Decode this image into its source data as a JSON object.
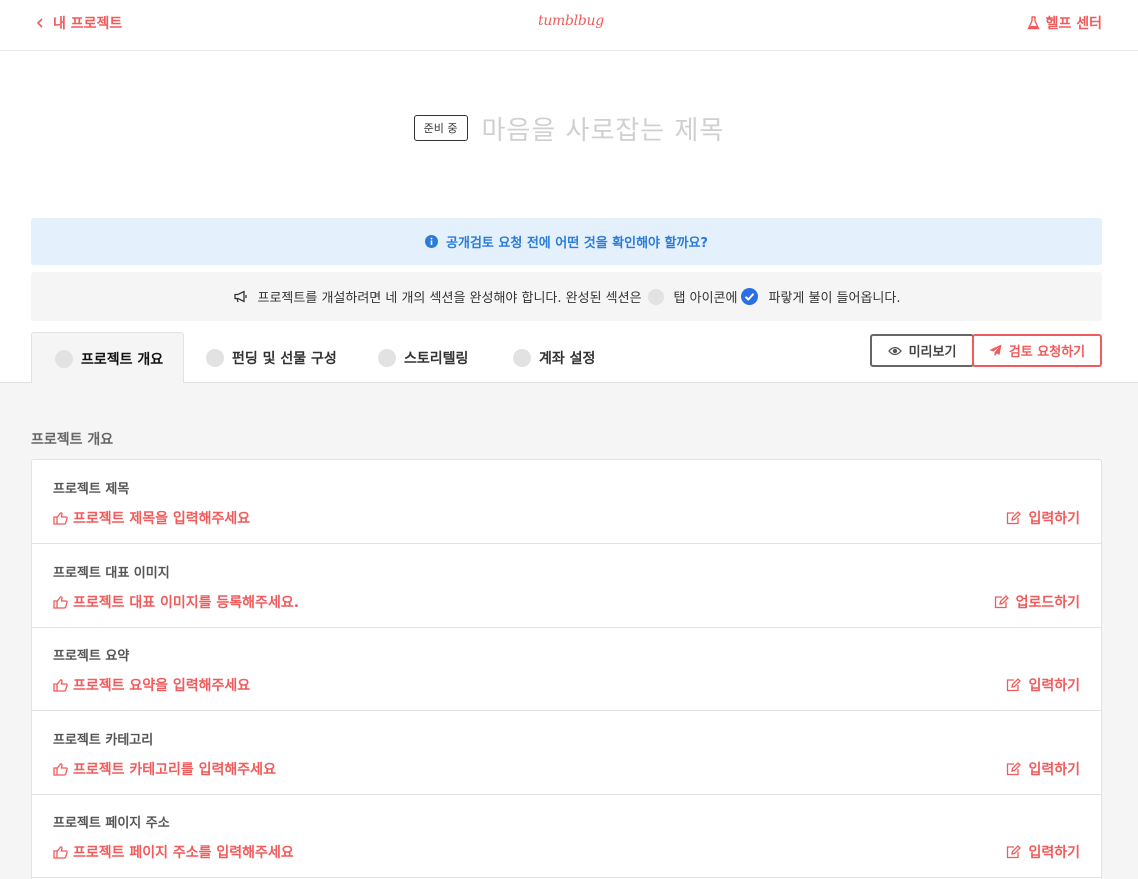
{
  "header": {
    "back_label": "내 프로젝트",
    "logo_text": "tumblbug",
    "help_label": "헬프 센터"
  },
  "title_area": {
    "status_badge": "준비 중",
    "title_placeholder": "마음을 사로잡는 제목"
  },
  "info_banner": {
    "text": "공개검토 요청 전에 어떤 것을 확인해야 할까요?"
  },
  "notice": {
    "part1": "프로젝트를 개설하려면 네 개의 섹션을 완성해야 합니다. 완성된 섹션은",
    "part2": "탭 아이콘에",
    "part3": "파랗게 불이 들어옵니다."
  },
  "tabs": [
    {
      "label": "프로젝트 개요",
      "active": true
    },
    {
      "label": "펀딩 및 선물 구성",
      "active": false
    },
    {
      "label": "스토리텔링",
      "active": false
    },
    {
      "label": "계좌 설정",
      "active": false
    }
  ],
  "actions": {
    "preview_label": "미리보기",
    "review_label": "검토 요청하기"
  },
  "section": {
    "title": "프로젝트 개요",
    "fields": [
      {
        "label": "프로젝트 제목",
        "prompt": "프로젝트 제목을 입력해주세요",
        "action": "입력하기"
      },
      {
        "label": "프로젝트 대표 이미지",
        "prompt": "프로젝트 대표 이미지를 등록해주세요.",
        "action": "업로드하기"
      },
      {
        "label": "프로젝트 요약",
        "prompt": "프로젝트 요약을 입력해주세요",
        "action": "입력하기"
      },
      {
        "label": "프로젝트 카테고리",
        "prompt": "프로젝트 카테고리를 입력해주세요",
        "action": "입력하기"
      },
      {
        "label": "프로젝트 페이지 주소",
        "prompt": "프로젝트 페이지 주소를 입력해주세요",
        "action": "입력하기"
      }
    ]
  },
  "colors": {
    "accent": "#f15b5b",
    "info_blue": "#2b7bd8",
    "check_blue": "#2b6fe4"
  }
}
